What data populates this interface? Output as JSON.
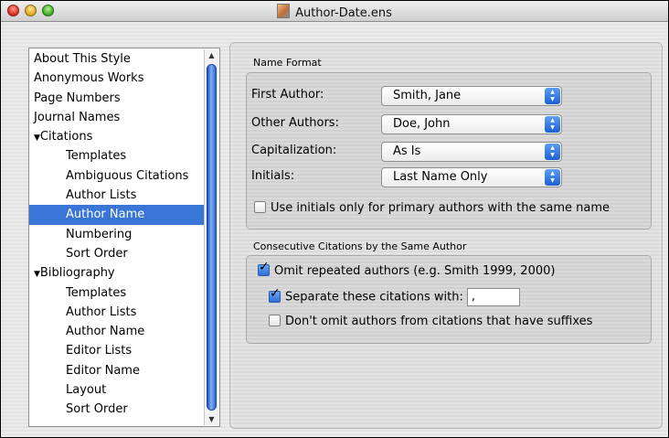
{
  "window": {
    "title": "Author-Date.ens"
  },
  "sidebar": {
    "items": [
      {
        "label": "About This Style",
        "indent": 0,
        "selected": false
      },
      {
        "label": "Anonymous Works",
        "indent": 0,
        "selected": false
      },
      {
        "label": "Page Numbers",
        "indent": 0,
        "selected": false
      },
      {
        "label": "Journal Names",
        "indent": 0,
        "selected": false
      },
      {
        "label": "Citations",
        "indent": 0,
        "selected": false,
        "expanded": true
      },
      {
        "label": "Templates",
        "indent": 1,
        "selected": false
      },
      {
        "label": "Ambiguous Citations",
        "indent": 1,
        "selected": false
      },
      {
        "label": "Author Lists",
        "indent": 1,
        "selected": false
      },
      {
        "label": "Author Name",
        "indent": 1,
        "selected": true
      },
      {
        "label": "Numbering",
        "indent": 1,
        "selected": false
      },
      {
        "label": "Sort Order",
        "indent": 1,
        "selected": false
      },
      {
        "label": "Bibliography",
        "indent": 0,
        "selected": false,
        "expanded": true
      },
      {
        "label": "Templates",
        "indent": 1,
        "selected": false
      },
      {
        "label": "Author Lists",
        "indent": 1,
        "selected": false
      },
      {
        "label": "Author Name",
        "indent": 1,
        "selected": false
      },
      {
        "label": "Editor Lists",
        "indent": 1,
        "selected": false
      },
      {
        "label": "Editor Name",
        "indent": 1,
        "selected": false
      },
      {
        "label": "Layout",
        "indent": 1,
        "selected": false
      },
      {
        "label": "Sort Order",
        "indent": 1,
        "selected": false
      }
    ],
    "selection_color": "#3875d7"
  },
  "name_format": {
    "group_title": "Name Format",
    "first_author": {
      "label": "First Author:",
      "value": "Smith, Jane"
    },
    "other_authors": {
      "label": "Other Authors:",
      "value": "Doe, John"
    },
    "capitalization": {
      "label": "Capitalization:",
      "value": "As Is"
    },
    "initials": {
      "label": "Initials:",
      "value": "Last Name Only"
    },
    "use_initials_checkbox": {
      "label": "Use initials only for primary authors with the same name",
      "checked": false
    }
  },
  "consecutive": {
    "group_title": "Consecutive Citations by the Same Author",
    "omit_repeated": {
      "label": "Omit repeated authors (e.g. Smith 1999, 2000)",
      "checked": true
    },
    "separate": {
      "label": "Separate these citations with:",
      "checked": true,
      "value": ","
    },
    "dont_omit": {
      "label": "Don't omit authors from citations that have suffixes",
      "checked": false
    }
  }
}
